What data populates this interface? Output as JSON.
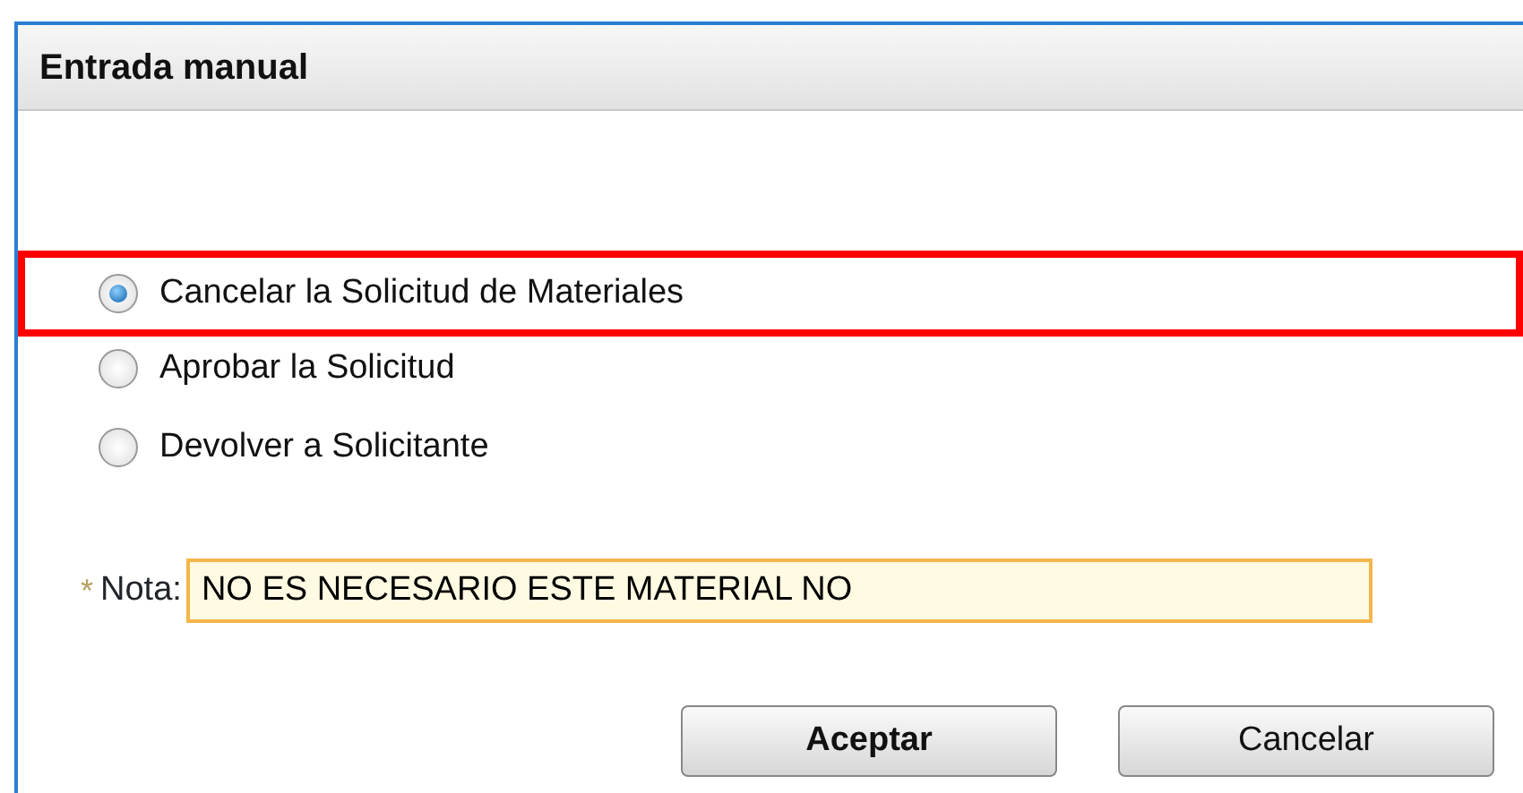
{
  "dialog": {
    "title": "Entrada manual"
  },
  "options": [
    {
      "label": "Cancelar la Solicitud de Materiales",
      "selected": true,
      "highlighted": true
    },
    {
      "label": "Aprobar la Solicitud",
      "selected": false,
      "highlighted": false
    },
    {
      "label": "Devolver a Solicitante",
      "selected": false,
      "highlighted": false
    }
  ],
  "note": {
    "required_mark": "*",
    "label": "Nota:",
    "value": "NO ES NECESARIO ESTE MATERIAL NO"
  },
  "buttons": [
    {
      "label": "Aceptar",
      "kind": "primary"
    },
    {
      "label": "Cancelar",
      "kind": "secondary"
    }
  ]
}
